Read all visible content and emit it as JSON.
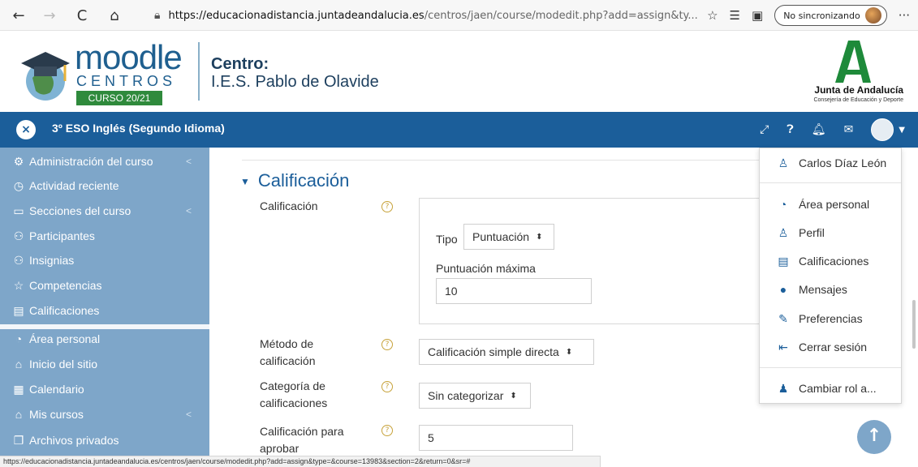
{
  "browser": {
    "back": "←",
    "forward": "→",
    "reload": "C",
    "home": "⌂",
    "url_host": "https://educacionadistancia.juntadeandalucia.es",
    "url_path": "/centros/jaen/course/modedit.php?add=assign&ty...",
    "sync_label": "No sincronizando",
    "more": "···"
  },
  "header": {
    "logo_word": "moodle",
    "logo_centros": "CENTROS",
    "logo_curso": "CURSO 20/21",
    "centro_label": "Centro:",
    "centro_name": "I.E.S. Pablo de Olavide",
    "junta_title": "Junta de Andalucía",
    "junta_sub": "Consejería de Educación y Deporte"
  },
  "navbar": {
    "close": "×",
    "course_title": "3º ESO Inglés (Segundo Idioma)"
  },
  "sidebar": {
    "items": [
      {
        "label": "Administración del curso",
        "icon": "gear-icon",
        "glyph": "⚙",
        "chevron": "<"
      },
      {
        "label": "Actividad reciente",
        "icon": "clock-icon",
        "glyph": "◷"
      },
      {
        "label": "Secciones del curso",
        "icon": "folder-icon",
        "glyph": "▭",
        "chevron": "<"
      },
      {
        "label": "Participantes",
        "icon": "users-icon",
        "glyph": "⚇"
      },
      {
        "label": "Insignias",
        "icon": "badge-icon",
        "glyph": "⚇"
      },
      {
        "label": "Competencias",
        "icon": "star-icon",
        "glyph": "☆"
      },
      {
        "label": "Calificaciones",
        "icon": "table-icon",
        "glyph": "▤"
      },
      {
        "label": "Área personal",
        "icon": "dashboard-icon",
        "glyph": "◔"
      },
      {
        "label": "Inicio del sitio",
        "icon": "home-icon",
        "glyph": "⌂"
      },
      {
        "label": "Calendario",
        "icon": "calendar-icon",
        "glyph": "▦"
      },
      {
        "label": "Mis cursos",
        "icon": "graduation-cap-icon",
        "glyph": "⌂",
        "chevron": "<"
      },
      {
        "label": "Archivos privados",
        "icon": "files-icon",
        "glyph": "❐"
      }
    ]
  },
  "form": {
    "section_title": "Calificación",
    "grade_label": "Calificación",
    "tipo_label": "Tipo",
    "tipo_value": "Puntuación",
    "max_label": "Puntuación máxima",
    "max_value": "10",
    "method_label_1": "Método de",
    "method_label_2": "calificación",
    "method_value": "Calificación simple directa",
    "category_label_1": "Categoría de",
    "category_label_2": "calificaciones",
    "category_value": "Sin categorizar",
    "pass_label_1": "Calificación para",
    "pass_label_2": "aprobar",
    "pass_value": "5",
    "help": "?"
  },
  "user_menu": {
    "items": [
      {
        "label": "Carlos Díaz León",
        "icon": "user-icon",
        "glyph": "♙"
      },
      {
        "label": "Área personal",
        "icon": "dashboard-icon",
        "glyph": "◔"
      },
      {
        "label": "Perfil",
        "icon": "user-icon",
        "glyph": "♙"
      },
      {
        "label": "Calificaciones",
        "icon": "table-icon",
        "glyph": "▤"
      },
      {
        "label": "Mensajes",
        "icon": "chat-bubble-icon",
        "glyph": "●"
      },
      {
        "label": "Preferencias",
        "icon": "wrench-icon",
        "glyph": "✎"
      },
      {
        "label": "Cerrar sesión",
        "icon": "logout-icon",
        "glyph": "⇤"
      },
      {
        "label": "Cambiar rol a...",
        "icon": "user-tie-icon",
        "glyph": "♟"
      }
    ]
  },
  "status_url": "https://educacionadistancia.juntadeandalucia.es/centros/jaen/course/modedit.php?add=assign&type=&course=13983&section=2&return=0&sr=#",
  "colors": {
    "brand_blue": "#1b5e9a",
    "sidebar_bg": "#7ea6c9",
    "logo_green": "#2f8a3c"
  }
}
